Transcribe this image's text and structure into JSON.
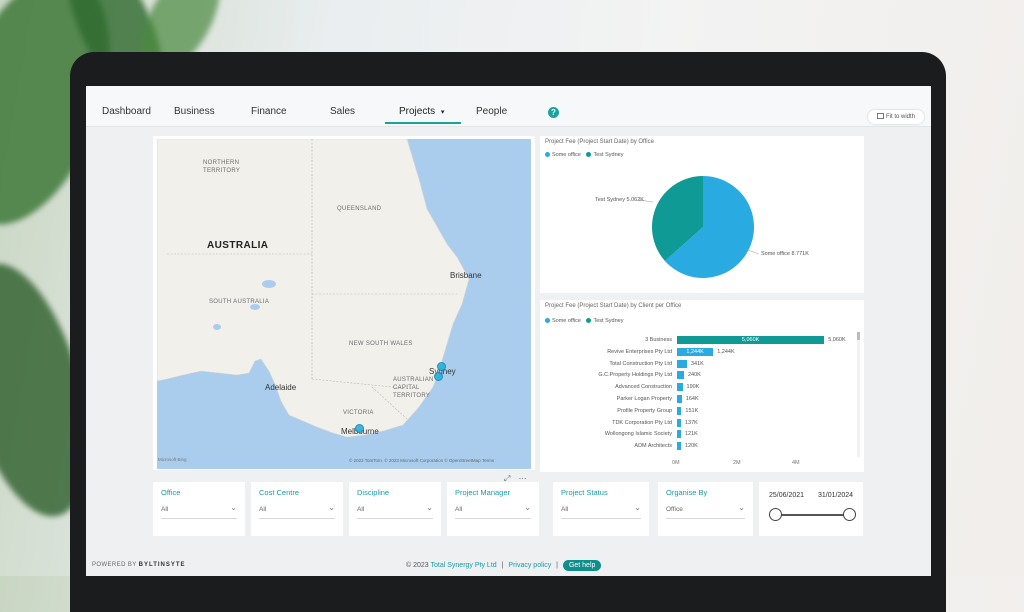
{
  "nav": {
    "tabs": [
      {
        "label": "Dashboard"
      },
      {
        "label": "Business"
      },
      {
        "label": "Finance"
      },
      {
        "label": "Sales"
      },
      {
        "label": "Projects",
        "chevron": "▾"
      },
      {
        "label": "People"
      }
    ],
    "help": "?",
    "fit_to_width": "Fit to width"
  },
  "map": {
    "regions": [
      "NORTHERN\nTERRITORY",
      "QUEENSLAND",
      "SOUTH AUSTRALIA",
      "NEW SOUTH WALES",
      "AUSTRALIAN\nCAPITAL\nTERRITORY",
      "VICTORIA"
    ],
    "country": "AUSTRALIA",
    "cities": [
      "Brisbane",
      "Adelaide",
      "Sydney",
      "Melbourne"
    ],
    "attribution": "© 2022 TomTom, © 2023 Microsoft Corporation © OpenStreetMap Terms",
    "logo": "Microsoft Bing",
    "water_color": "#aacdee",
    "land_color": "#f2f0eb"
  },
  "pie": {
    "title": "Project Fee (Project Start Date) by Office",
    "legend": [
      {
        "name": "Some office",
        "color": "#29abe2"
      },
      {
        "name": "Test Sydney",
        "color": "#0f9a96"
      }
    ],
    "label_a": "Test Sydney 5.062K",
    "label_b": "Some office 8.771K"
  },
  "bar": {
    "title": "Project Fee (Project Start Date) by Client per Office",
    "legend": [
      {
        "name": "Some office",
        "color": "#29abe2"
      },
      {
        "name": "Test Sydney",
        "color": "#0f9a96"
      }
    ],
    "axis_ticks": [
      "0M",
      "2M",
      "4M"
    ]
  },
  "chart_data": [
    {
      "type": "pie",
      "title": "Project Fee (Project Start Date) by Office",
      "categories": [
        "Some office",
        "Test Sydney"
      ],
      "values": [
        8771,
        5062
      ],
      "legend": "top-left",
      "colors": [
        "#29abe2",
        "#0f9a96"
      ]
    },
    {
      "type": "bar",
      "orientation": "horizontal",
      "title": "Project Fee (Project Start Date) by Client per Office",
      "categories": [
        "3 Business",
        "Revive Enterprises Pty Ltd",
        "Total Construction Pty Ltd",
        "G.C.Property Holdings Pty Ltd",
        "Advanced Construction",
        "Parker Logan Property",
        "Profile Property Group",
        "TDK Corporation Pty Ltd",
        "Wollongong Islamic Society",
        "ADM Architects"
      ],
      "values": [
        5060,
        1244,
        341,
        240,
        190,
        164,
        151,
        137,
        121,
        120
      ],
      "value_labels": [
        "5,060K",
        "1,244K",
        "341K",
        "240K",
        "190K",
        "164K",
        "151K",
        "137K",
        "121K",
        "120K"
      ],
      "inbar_labels": [
        "5,060K",
        "1,244K"
      ],
      "series_colors": [
        "#0f9a96",
        "#29abe2"
      ],
      "x_ticks": [
        "0M",
        "2M",
        "4M"
      ],
      "xlim": [
        0,
        5500
      ],
      "legend": "top-left"
    }
  ],
  "filters": [
    {
      "label": "Office",
      "value": "All"
    },
    {
      "label": "Cost Centre",
      "value": "All"
    },
    {
      "label": "Discipline",
      "value": "All"
    },
    {
      "label": "Project Manager",
      "value": "All"
    },
    {
      "label": "Project Status",
      "value": "All"
    },
    {
      "label": "Organise By",
      "value": "Office"
    }
  ],
  "dates": {
    "start": "25/06/2021",
    "end": "31/01/2024"
  },
  "footer": {
    "powered": "POWERED BY",
    "brand": "BYLTINSYTE",
    "copyright": "© 2023",
    "company": "Total Synergy Pty Ltd",
    "sep": "|",
    "privacy": "Privacy policy",
    "help": "Get help"
  }
}
